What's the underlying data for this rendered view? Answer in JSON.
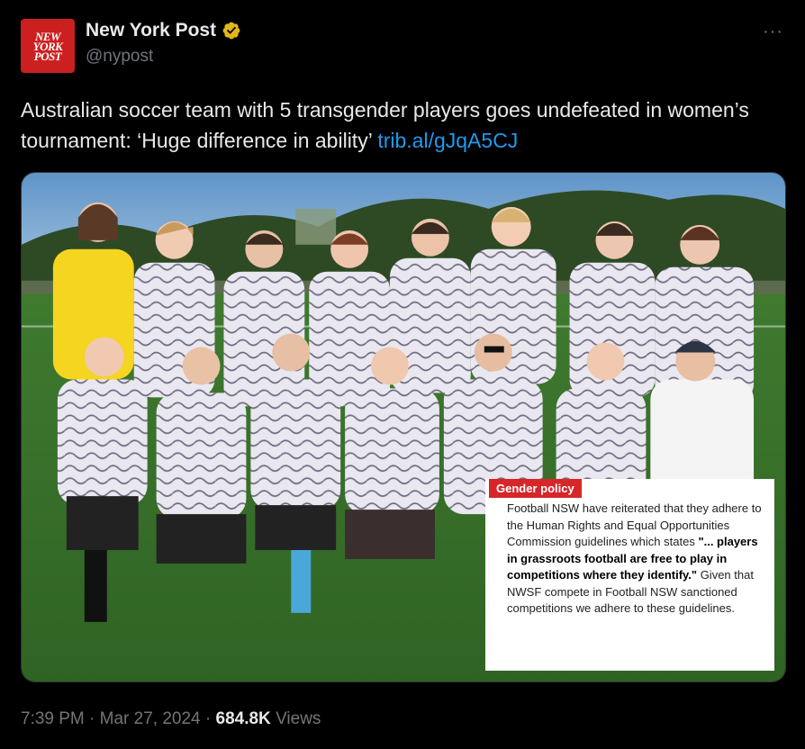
{
  "author": {
    "avatar_lines": [
      "NEW",
      "YORK",
      "POST"
    ],
    "display_name": "New York Post",
    "handle": "@nypost",
    "verified_icon": "gold-verified-badge",
    "more_icon": "ellipsis-icon",
    "more_label": "···"
  },
  "tweet": {
    "text": "Australian soccer team with 5 transgender players goes undefeated in women’s tournament: ‘Huge difference in ability’ ",
    "link": "trib.al/gJqA5CJ"
  },
  "media": {
    "overlay": {
      "tag": "Gender policy",
      "text_before": "Football NSW have reiterated that they adhere to the Human Rights and Equal Opportunities Commission guidelines which states ",
      "text_bold": "\"... players in grassroots football are free to play in competitions where they identify.\"",
      "text_after": " Given that NWSF compete in Football NSW sanctioned competitions we adhere to these guidelines."
    }
  },
  "meta": {
    "time": "7:39 PM",
    "sep1": " · ",
    "date": "Mar 27, 2024",
    "sep2": " · ",
    "views_count": "684.8K",
    "views_label": " Views"
  },
  "colors": {
    "accent": "#1d9bf0",
    "brand_red": "#cc1f1f",
    "verified_gold": "#e2b719",
    "tag_red": "#d6262a"
  }
}
